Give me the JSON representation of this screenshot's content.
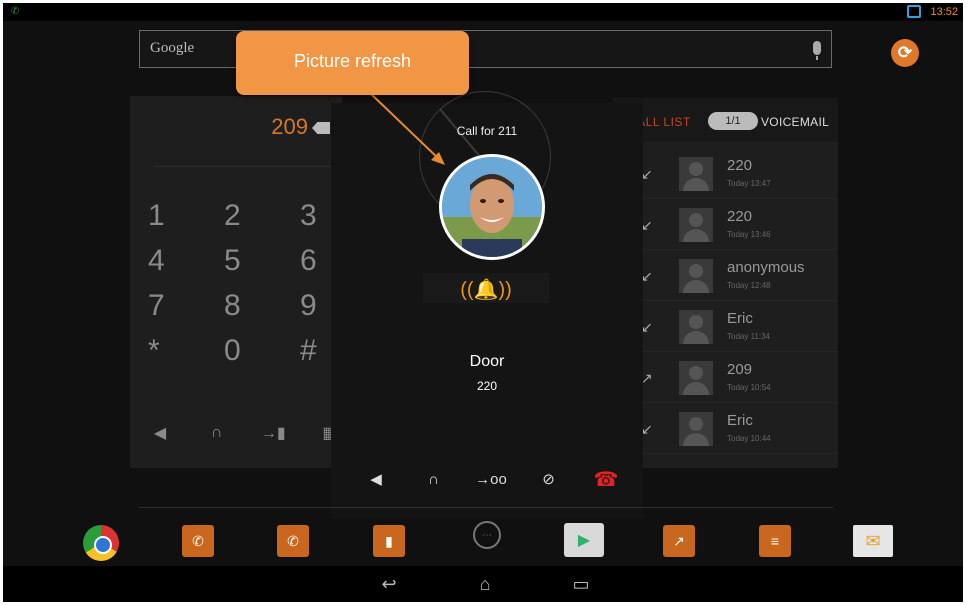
{
  "status": {
    "left_icon": "phone-icon",
    "time": "13:52"
  },
  "search": {
    "placeholder": "Google"
  },
  "dialer": {
    "display": "209",
    "keys": [
      "1",
      "2",
      "3",
      "4",
      "5",
      "6",
      "7",
      "8",
      "9",
      "*",
      "0",
      "#"
    ]
  },
  "call_list": {
    "tab_call_list": "CALL LIST",
    "tab_counter": "1/1",
    "tab_voicemail": "VOICEMAIL",
    "rows": [
      {
        "name": "220",
        "time": "Today 13:47",
        "icon": "incoming-call-icon"
      },
      {
        "name": "220",
        "time": "Today 13:46",
        "icon": "incoming-call-icon"
      },
      {
        "name": "anonymous",
        "time": "Today 12:48",
        "icon": "incoming-call-icon"
      },
      {
        "name": "Eric",
        "time": "Today 11:34",
        "icon": "incoming-call-icon"
      },
      {
        "name": "209",
        "time": "Today 10:54",
        "icon": "outgoing-call-icon"
      },
      {
        "name": "Eric",
        "time": "Today 10:44",
        "icon": "incoming-call-icon"
      }
    ]
  },
  "call": {
    "title": "Call for 211",
    "caller_name": "Door",
    "caller_number": "220"
  },
  "callout": {
    "text": "Picture refresh"
  },
  "colors": {
    "accent": "#f09645",
    "hangup": "#e02424",
    "background": "#101010"
  }
}
